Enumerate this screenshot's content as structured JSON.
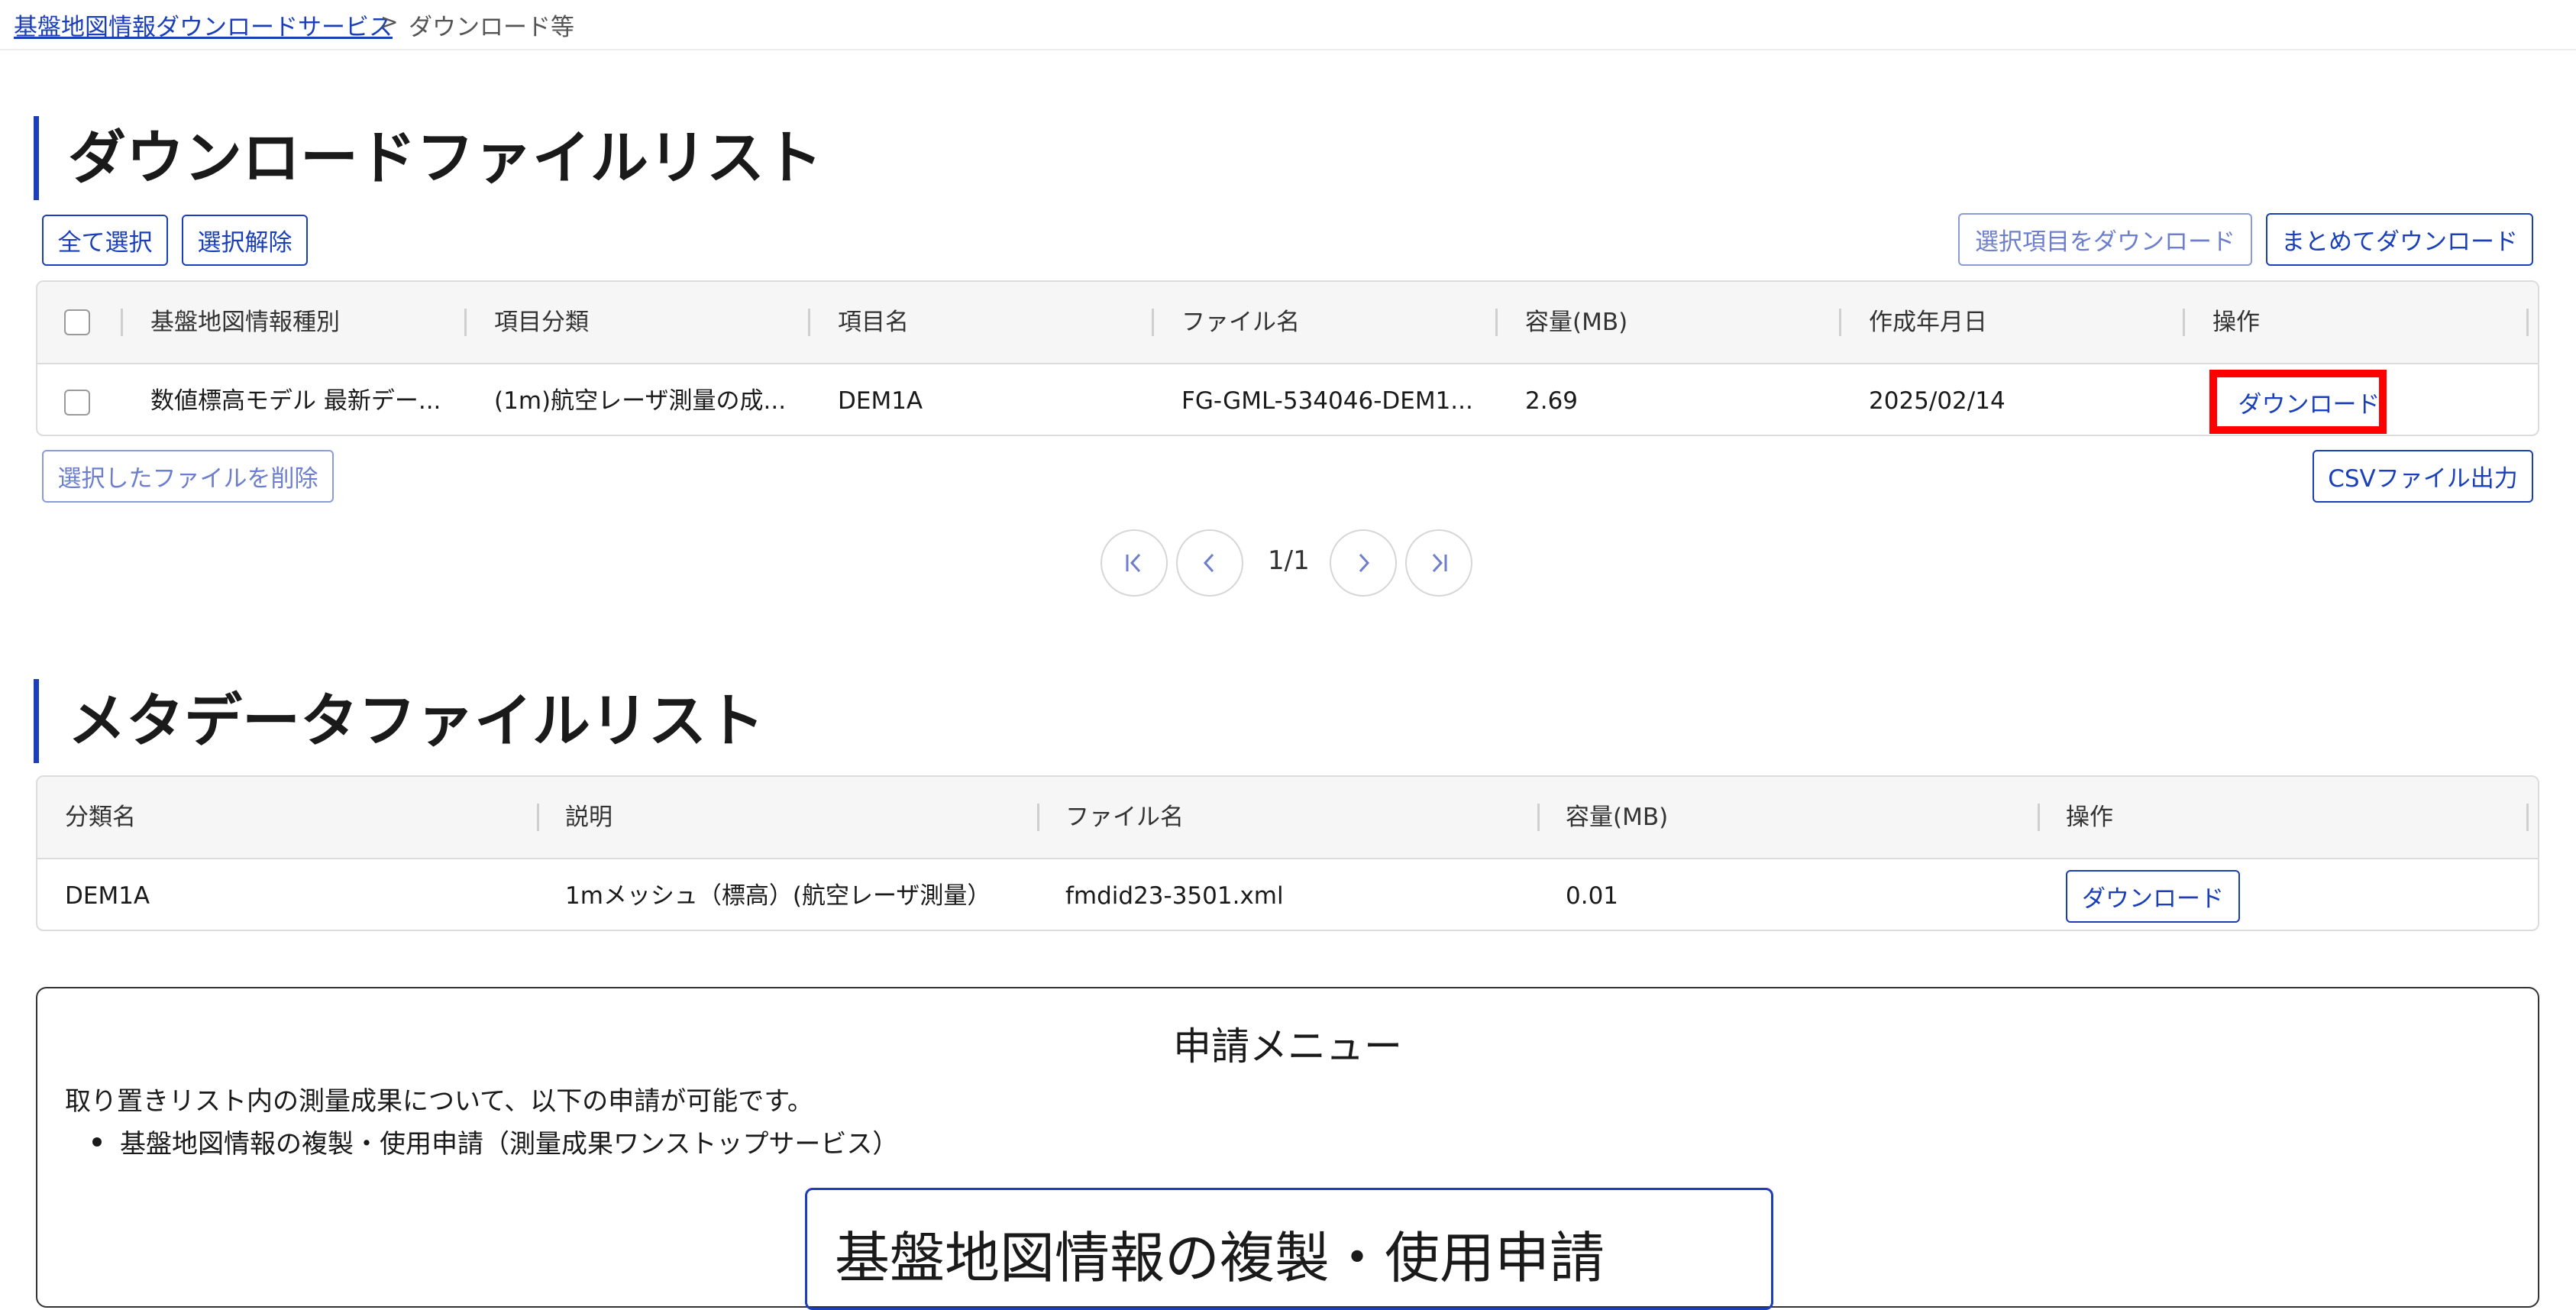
{
  "breadcrumb": {
    "link": "基盤地図情報ダウンロードサービス",
    "separator": ">",
    "current": "ダウンロード等"
  },
  "download_section": {
    "title": "ダウンロードファイルリスト",
    "select_all": "全て選択",
    "deselect": "選択解除",
    "download_selected": "選択項目をダウンロード",
    "download_all": "まとめてダウンロード",
    "columns": [
      "基盤地図情報種別",
      "項目分類",
      "項目名",
      "ファイル名",
      "容量(MB)",
      "作成年月日",
      "操作"
    ],
    "rows": [
      {
        "type": "数値標高モデル 最新デー...",
        "category": "(1m)航空レーザ測量の成...",
        "item": "DEM1A",
        "file": "FG-GML-534046-DEM1...",
        "size": "2.69",
        "date": "2025/02/14",
        "action": "ダウンロード"
      }
    ],
    "delete_selected": "選択したファイルを削除",
    "csv_export": "CSVファイル出力",
    "pagination": "1/1"
  },
  "metadata_section": {
    "title": "メタデータファイルリスト",
    "columns": [
      "分類名",
      "説明",
      "ファイル名",
      "容量(MB)",
      "操作"
    ],
    "rows": [
      {
        "category": "DEM1A",
        "description": "1mメッシュ（標高）(航空レーザ測量）",
        "file": "fmdid23-3501.xml",
        "size": "0.01",
        "action": "ダウンロード"
      }
    ]
  },
  "application_menu": {
    "title": "申請メニュー",
    "description": "取り置きリスト内の測量成果について、以下の申請が可能です。",
    "items": [
      "基盤地図情報の複製・使用申請（測量成果ワンストップサービス）"
    ],
    "button": "基盤地図情報の複製・使用申請"
  },
  "colors": {
    "accent": "#1a3fb8",
    "highlight": "#ff0000"
  }
}
